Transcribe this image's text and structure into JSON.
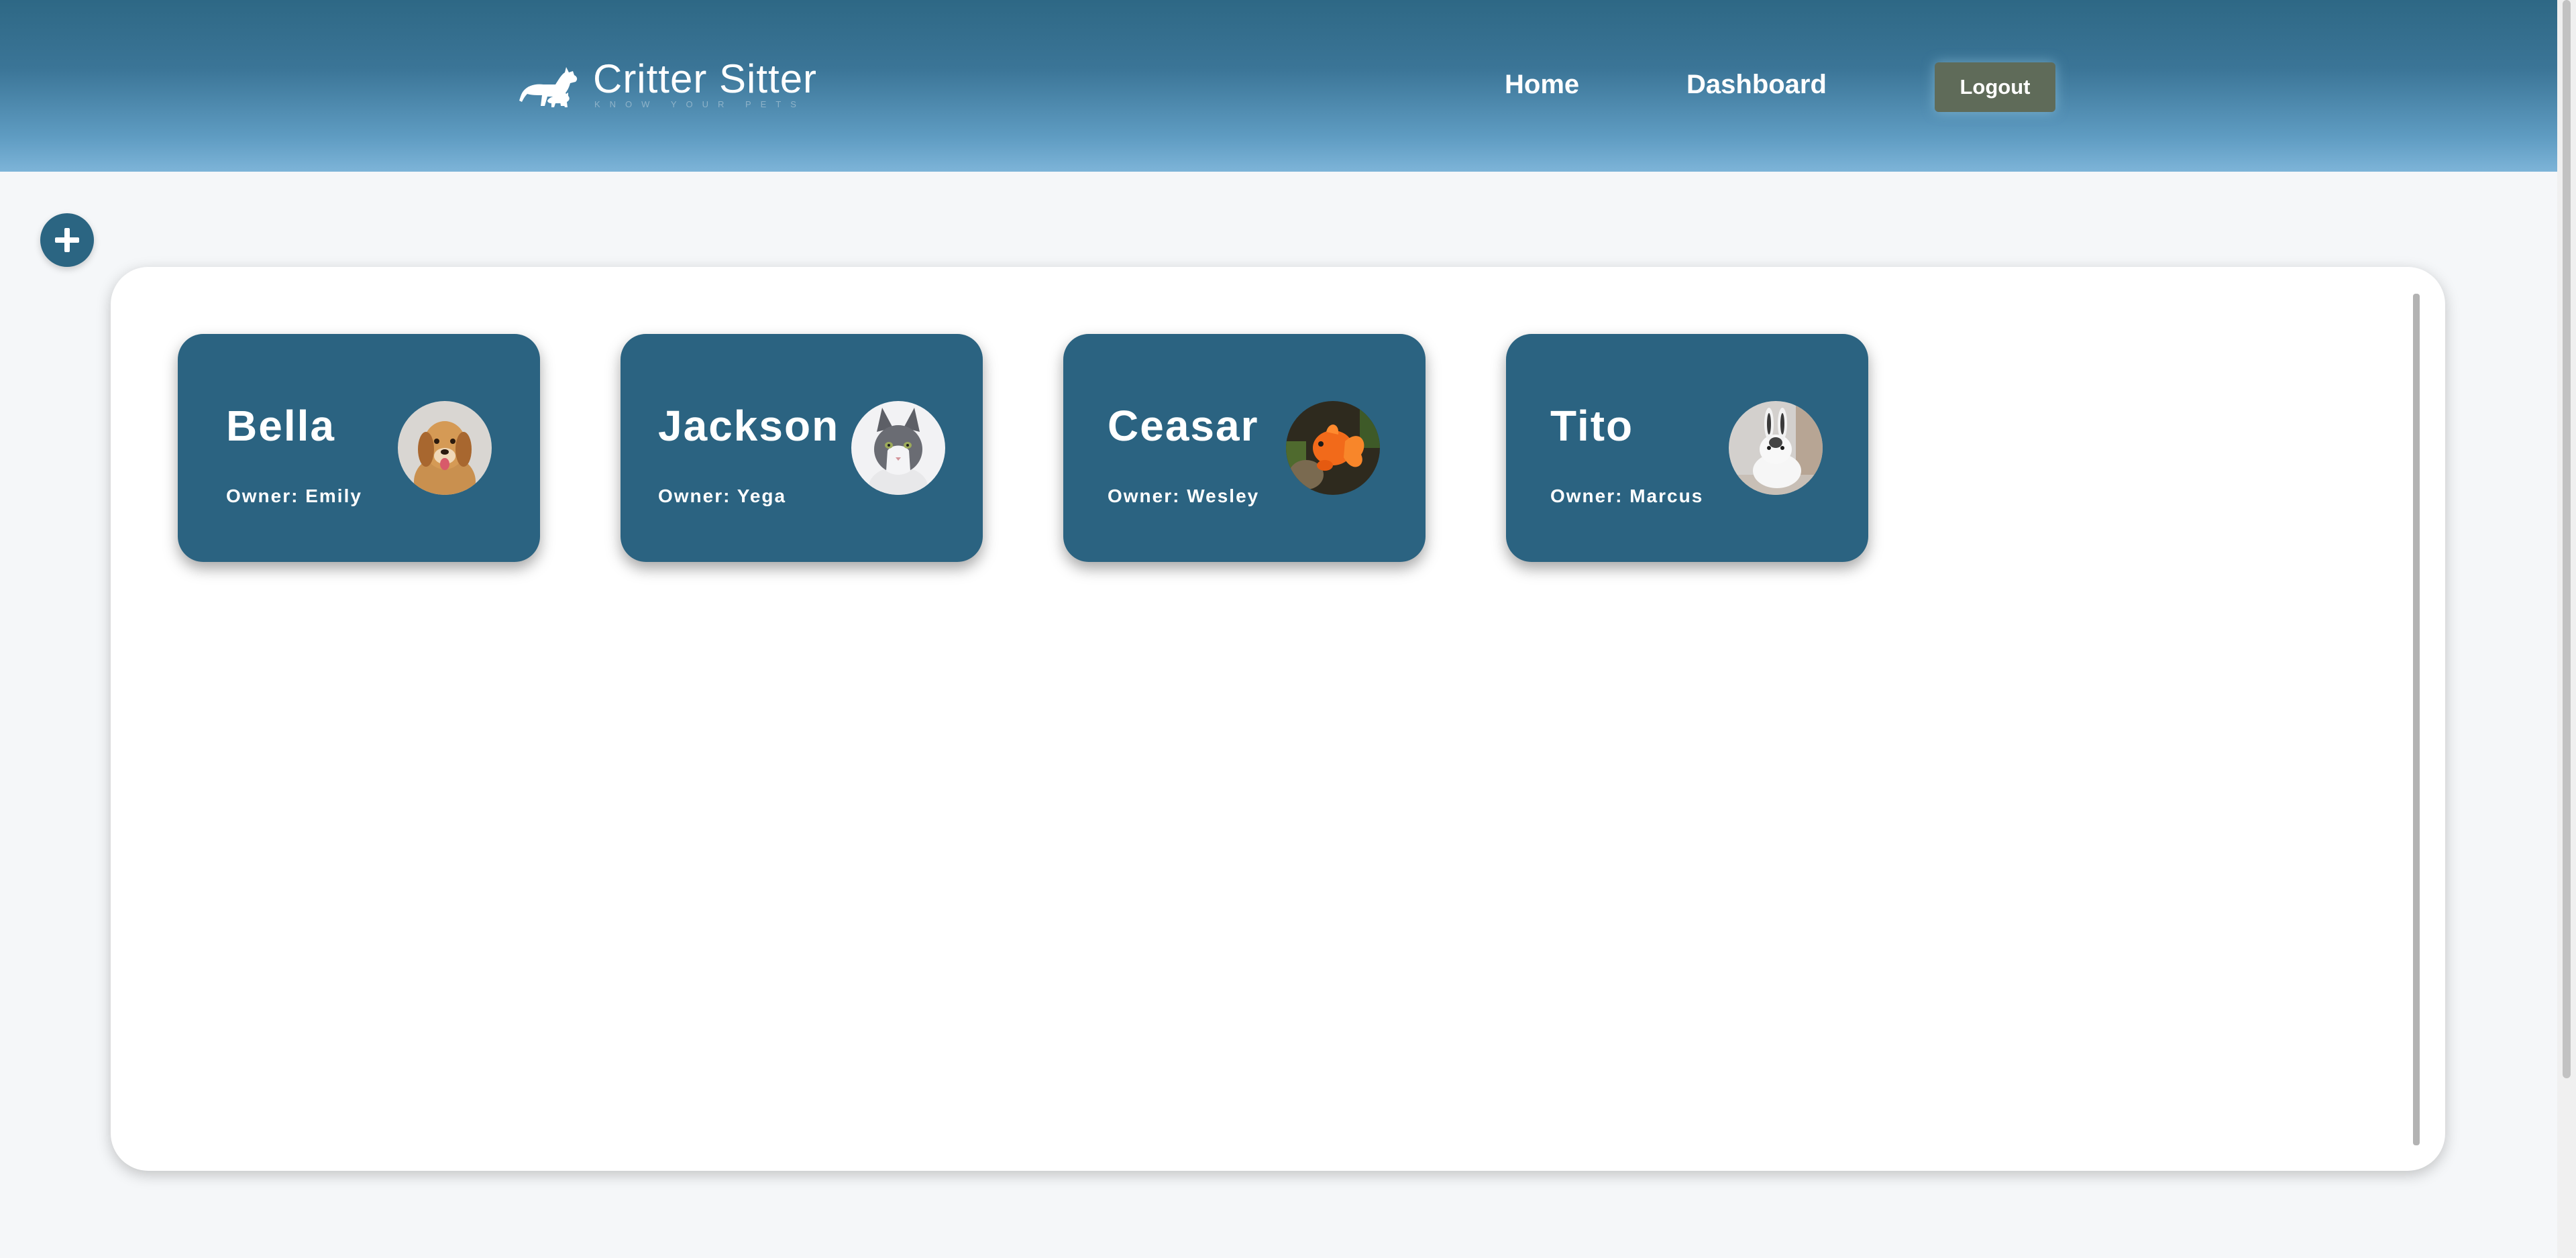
{
  "app": {
    "name": "Critter Sitter",
    "tagline": "Know your pets"
  },
  "nav": {
    "home": "Home",
    "dashboard": "Dashboard",
    "logout": "Logout"
  },
  "actions": {
    "add_icon": "plus-icon"
  },
  "pets": [
    {
      "name": "Bella",
      "owner": "Owner: Emily",
      "photo": "dog-photo"
    },
    {
      "name": "Jackson",
      "owner": "Owner: Yega",
      "photo": "cat-photo"
    },
    {
      "name": "Ceasar",
      "owner": "Owner: Wesley",
      "photo": "goldfish-photo"
    },
    {
      "name": "Tito",
      "owner": "Owner: Marcus",
      "photo": "rabbit-photo"
    }
  ],
  "colors": {
    "header_top": "#2e6885",
    "header_bottom": "#7db4d8",
    "card": "#2b6381",
    "logout_button": "#5f6b59",
    "page_background": "#f5f7f9"
  }
}
